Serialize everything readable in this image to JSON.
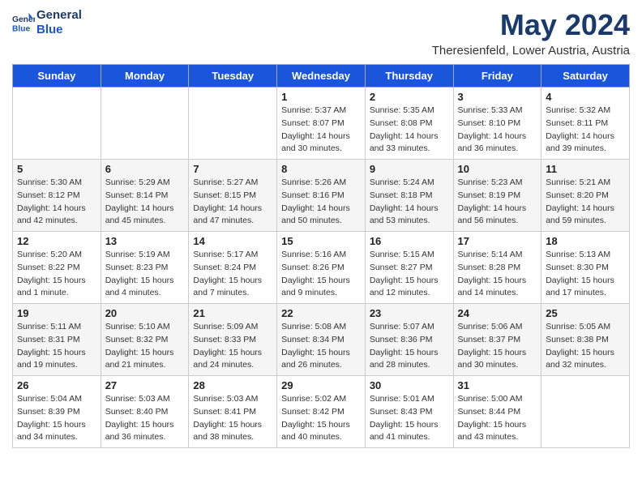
{
  "header": {
    "logo_line1": "General",
    "logo_line2": "Blue",
    "month": "May 2024",
    "location": "Theresienfeld, Lower Austria, Austria"
  },
  "days_of_week": [
    "Sunday",
    "Monday",
    "Tuesday",
    "Wednesday",
    "Thursday",
    "Friday",
    "Saturday"
  ],
  "weeks": [
    [
      {
        "day": "",
        "info": ""
      },
      {
        "day": "",
        "info": ""
      },
      {
        "day": "",
        "info": ""
      },
      {
        "day": "1",
        "info": "Sunrise: 5:37 AM\nSunset: 8:07 PM\nDaylight: 14 hours\nand 30 minutes."
      },
      {
        "day": "2",
        "info": "Sunrise: 5:35 AM\nSunset: 8:08 PM\nDaylight: 14 hours\nand 33 minutes."
      },
      {
        "day": "3",
        "info": "Sunrise: 5:33 AM\nSunset: 8:10 PM\nDaylight: 14 hours\nand 36 minutes."
      },
      {
        "day": "4",
        "info": "Sunrise: 5:32 AM\nSunset: 8:11 PM\nDaylight: 14 hours\nand 39 minutes."
      }
    ],
    [
      {
        "day": "5",
        "info": "Sunrise: 5:30 AM\nSunset: 8:12 PM\nDaylight: 14 hours\nand 42 minutes."
      },
      {
        "day": "6",
        "info": "Sunrise: 5:29 AM\nSunset: 8:14 PM\nDaylight: 14 hours\nand 45 minutes."
      },
      {
        "day": "7",
        "info": "Sunrise: 5:27 AM\nSunset: 8:15 PM\nDaylight: 14 hours\nand 47 minutes."
      },
      {
        "day": "8",
        "info": "Sunrise: 5:26 AM\nSunset: 8:16 PM\nDaylight: 14 hours\nand 50 minutes."
      },
      {
        "day": "9",
        "info": "Sunrise: 5:24 AM\nSunset: 8:18 PM\nDaylight: 14 hours\nand 53 minutes."
      },
      {
        "day": "10",
        "info": "Sunrise: 5:23 AM\nSunset: 8:19 PM\nDaylight: 14 hours\nand 56 minutes."
      },
      {
        "day": "11",
        "info": "Sunrise: 5:21 AM\nSunset: 8:20 PM\nDaylight: 14 hours\nand 59 minutes."
      }
    ],
    [
      {
        "day": "12",
        "info": "Sunrise: 5:20 AM\nSunset: 8:22 PM\nDaylight: 15 hours\nand 1 minute."
      },
      {
        "day": "13",
        "info": "Sunrise: 5:19 AM\nSunset: 8:23 PM\nDaylight: 15 hours\nand 4 minutes."
      },
      {
        "day": "14",
        "info": "Sunrise: 5:17 AM\nSunset: 8:24 PM\nDaylight: 15 hours\nand 7 minutes."
      },
      {
        "day": "15",
        "info": "Sunrise: 5:16 AM\nSunset: 8:26 PM\nDaylight: 15 hours\nand 9 minutes."
      },
      {
        "day": "16",
        "info": "Sunrise: 5:15 AM\nSunset: 8:27 PM\nDaylight: 15 hours\nand 12 minutes."
      },
      {
        "day": "17",
        "info": "Sunrise: 5:14 AM\nSunset: 8:28 PM\nDaylight: 15 hours\nand 14 minutes."
      },
      {
        "day": "18",
        "info": "Sunrise: 5:13 AM\nSunset: 8:30 PM\nDaylight: 15 hours\nand 17 minutes."
      }
    ],
    [
      {
        "day": "19",
        "info": "Sunrise: 5:11 AM\nSunset: 8:31 PM\nDaylight: 15 hours\nand 19 minutes."
      },
      {
        "day": "20",
        "info": "Sunrise: 5:10 AM\nSunset: 8:32 PM\nDaylight: 15 hours\nand 21 minutes."
      },
      {
        "day": "21",
        "info": "Sunrise: 5:09 AM\nSunset: 8:33 PM\nDaylight: 15 hours\nand 24 minutes."
      },
      {
        "day": "22",
        "info": "Sunrise: 5:08 AM\nSunset: 8:34 PM\nDaylight: 15 hours\nand 26 minutes."
      },
      {
        "day": "23",
        "info": "Sunrise: 5:07 AM\nSunset: 8:36 PM\nDaylight: 15 hours\nand 28 minutes."
      },
      {
        "day": "24",
        "info": "Sunrise: 5:06 AM\nSunset: 8:37 PM\nDaylight: 15 hours\nand 30 minutes."
      },
      {
        "day": "25",
        "info": "Sunrise: 5:05 AM\nSunset: 8:38 PM\nDaylight: 15 hours\nand 32 minutes."
      }
    ],
    [
      {
        "day": "26",
        "info": "Sunrise: 5:04 AM\nSunset: 8:39 PM\nDaylight: 15 hours\nand 34 minutes."
      },
      {
        "day": "27",
        "info": "Sunrise: 5:03 AM\nSunset: 8:40 PM\nDaylight: 15 hours\nand 36 minutes."
      },
      {
        "day": "28",
        "info": "Sunrise: 5:03 AM\nSunset: 8:41 PM\nDaylight: 15 hours\nand 38 minutes."
      },
      {
        "day": "29",
        "info": "Sunrise: 5:02 AM\nSunset: 8:42 PM\nDaylight: 15 hours\nand 40 minutes."
      },
      {
        "day": "30",
        "info": "Sunrise: 5:01 AM\nSunset: 8:43 PM\nDaylight: 15 hours\nand 41 minutes."
      },
      {
        "day": "31",
        "info": "Sunrise: 5:00 AM\nSunset: 8:44 PM\nDaylight: 15 hours\nand 43 minutes."
      },
      {
        "day": "",
        "info": ""
      }
    ]
  ]
}
